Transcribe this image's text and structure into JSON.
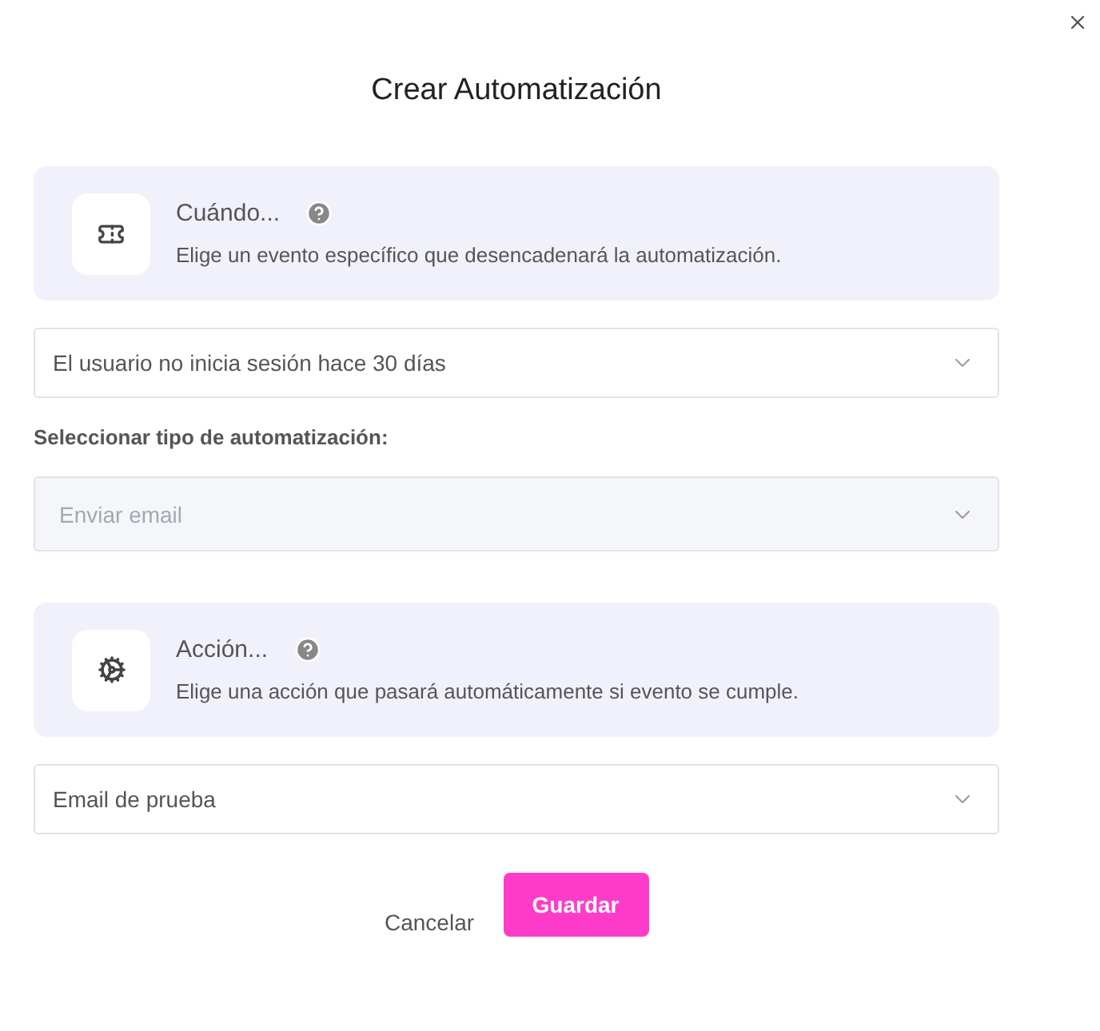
{
  "title": "Crear Automatización",
  "trigger": {
    "kind": "event",
    "heading": "Cuándo...",
    "description": "Elige un evento específico que desencadenará la automatización."
  },
  "trigger_select": {
    "value": "El usuario no inicia sesión hace 30 días",
    "disabled": false
  },
  "type_label": "Seleccionar tipo de automatización:",
  "type_select": {
    "value": "Enviar email",
    "disabled": true
  },
  "action": {
    "kind": "action",
    "heading": "Acción...",
    "description": "Elige una acción que pasará automáticamente si evento se cumple."
  },
  "action_select": {
    "value": "Email de prueba",
    "disabled": false
  },
  "buttons": {
    "cancel": "Cancelar",
    "save": "Guardar"
  }
}
